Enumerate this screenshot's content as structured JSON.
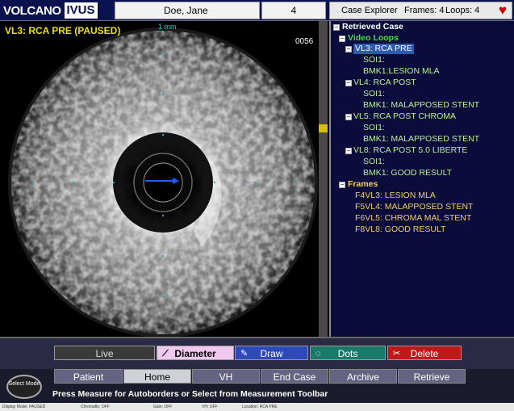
{
  "header": {
    "logo_brand": "VOLCANO",
    "logo_product": "IVUS",
    "patient_name": "Doe, Jane",
    "patient_id": "4",
    "explorer_title": "Case Explorer",
    "frames_label": "Frames: 4",
    "loops_label": "Loops: 4",
    "heart_icon": "heart-icon"
  },
  "image": {
    "title": "VL3: RCA PRE (PAUSED)",
    "scale": "1 mm",
    "frame_number": "0056"
  },
  "tree": {
    "root": "Retrieved Case",
    "video_loops_label": "Video Loops",
    "loops": [
      {
        "label": "VL3: RCA PRE",
        "soi": "SOI1:",
        "bmk": "BMK1:LESION MLA"
      },
      {
        "label": "VL4: RCA POST",
        "soi": "SOI1:",
        "bmk": "BMK1: MALAPPOSED STENT"
      },
      {
        "label": "VL5: RCA POST CHROMA",
        "soi": "SOI1:",
        "bmk": "BMK1: MALAPPOSED STENT"
      },
      {
        "label": "VL8: RCA POST 5.0 LIBERTE",
        "soi": "SOI1:",
        "bmk": "BMK1: GOOD RESULT"
      }
    ],
    "frames_label": "Frames",
    "frames": [
      "F4VL3: LESION MLA",
      "F5VL4: MALAPPOSED STENT",
      "F6VL5: CHROMA MAL STENT",
      "F8VL8: GOOD RESULT"
    ]
  },
  "toolbar": {
    "live": "Live",
    "diameter": "Diameter",
    "draw": "Draw",
    "dots": "Dots",
    "delete": "Delete"
  },
  "nav": {
    "select_mode": "Select Mode",
    "tabs": [
      "Patient",
      "Home",
      "VH",
      "End Case",
      "Archive",
      "Retrieve"
    ],
    "active_tab": "Home",
    "status_message": "Press Measure for Autoborders or Select from Measurement Toolbar"
  },
  "statusbar": {
    "items": [
      "Display Mode: PAUSED",
      "Chromaflo: OFF",
      "Gain: OFF",
      "VH: OFF",
      "Location: RCA PRE"
    ]
  },
  "colors": {
    "title_yellow": "#f0e000",
    "tree_bg": "#0b0b3c",
    "delete_red": "#c01818",
    "draw_blue": "#2d4ab8"
  }
}
